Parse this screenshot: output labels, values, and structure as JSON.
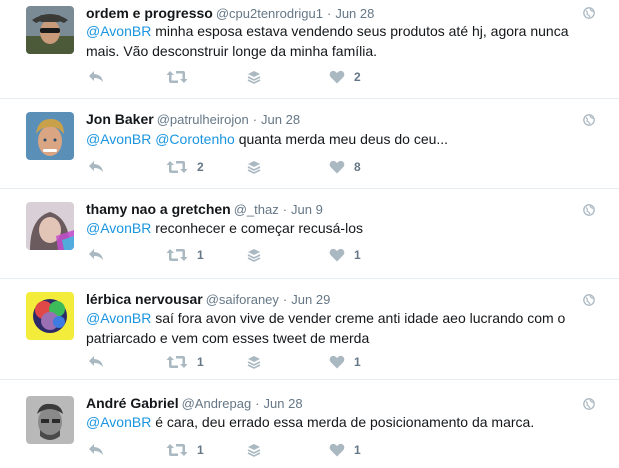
{
  "tweets": [
    {
      "name": "ordem e progresso",
      "handle": "@cpu2tenrodrigu1",
      "date": "Jun 28",
      "mentions": [
        "@AvonBR"
      ],
      "body": " minha esposa estava vendendo seus produtos até hj, agora nunca mais.  Vão desconstruir longe da minha família.",
      "retweets": "",
      "likes": "2",
      "avatar_colors": {
        "bg": "#7a8b96",
        "face": "#c99b7a",
        "hat": "#3a3a36"
      }
    },
    {
      "name": "Jon Baker",
      "handle": "@patrulheirojon",
      "date": "Jun 28",
      "mentions": [
        "@AvonBR",
        "@Corotenho"
      ],
      "body": " quanta merda meu deus do ceu...",
      "retweets": "2",
      "likes": "8",
      "avatar_colors": {
        "bg": "#5a8fb8",
        "face": "#d9a582",
        "hair": "#c9a14a"
      }
    },
    {
      "name": "thamy nao a gretchen",
      "handle": "@_thaz",
      "date": "Jun 9",
      "mentions": [
        "@AvonBR"
      ],
      "body": " reconhecer e começar recusá-los",
      "retweets": "1",
      "likes": "1",
      "avatar_colors": {
        "bg": "#d8d0d6",
        "face": "#e3c5b8",
        "hair": "#6b5a5e"
      }
    },
    {
      "name": "lérbica nervousar",
      "handle": "@saiforaney",
      "date": "Jun 29",
      "mentions": [
        "@AvonBR"
      ],
      "body": " saí fora avon vive de vender creme anti idade aeo lucrando com o patriarcado e vem com esses tweet de merda",
      "retweets": "1",
      "likes": "1",
      "avatar_colors": {
        "bg": "#f3ec3a",
        "face": "#9a6fb3",
        "hair": "#2d2a6a"
      }
    },
    {
      "name": "André Gabriel",
      "handle": "@Andrepag",
      "date": "Jun 28",
      "mentions": [
        "@AvonBR"
      ],
      "body": " é cara, deu errado essa merda de posicionamento da marca.",
      "retweets": "1",
      "likes": "1",
      "avatar_colors": {
        "bg": "#b9b9b9",
        "face": "#8a8a8a",
        "hair": "#3a3a3a"
      }
    }
  ],
  "icons": {
    "reply": "reply-icon",
    "retweet": "retweet-icon",
    "stack": "stack-icon",
    "like": "heart-icon",
    "globe": "globe-icon"
  },
  "colors": {
    "mention": "#1b95e0",
    "action": "#aab8c2",
    "divider": "#e6ecf0"
  }
}
